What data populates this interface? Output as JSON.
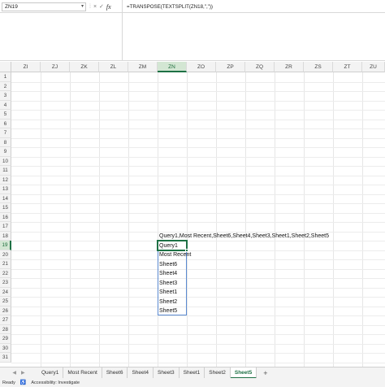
{
  "formula_bar": {
    "name_box": "ZN19",
    "formula": "=TRANSPOSE(TEXTSPLIT(ZN18,\",\"))",
    "fx_label": "fx",
    "cancel_icon": "×",
    "enter_icon": "✓"
  },
  "columns": [
    "ZI",
    "ZJ",
    "ZK",
    "ZL",
    "ZM",
    "ZN",
    "ZO",
    "ZP",
    "ZQ",
    "ZR",
    "ZS",
    "ZT",
    "ZU"
  ],
  "active_column": "ZN",
  "rows": [
    "1",
    "2",
    "3",
    "4",
    "5",
    "6",
    "7",
    "8",
    "9",
    "10",
    "11",
    "12",
    "13",
    "14",
    "15",
    "16",
    "17",
    "18",
    "19",
    "20",
    "21",
    "22",
    "23",
    "24",
    "25",
    "26",
    "27",
    "28",
    "29",
    "30",
    "31"
  ],
  "active_row": "19",
  "cells": {
    "zn18": "Query1,Most Recent,Sheet6,Sheet4,Sheet3,Sheet1,Sheet2,Sheet5",
    "spill": [
      "Query1",
      "Most Recent",
      "Sheet6",
      "Sheet4",
      "Sheet3",
      "Sheet1",
      "Sheet2",
      "Sheet5"
    ]
  },
  "sheet_tabs": [
    "Query1",
    "Most Recent",
    "Sheet6",
    "Sheet4",
    "Sheet3",
    "Sheet1",
    "Sheet2",
    "Sheet5"
  ],
  "active_sheet": "Sheet5",
  "add_sheet_label": "+",
  "status": {
    "ready": "Ready",
    "accessibility": "Accessibility: Investigate"
  },
  "colors": {
    "accent": "#1e7145",
    "spill_border": "#5b8ad1"
  }
}
